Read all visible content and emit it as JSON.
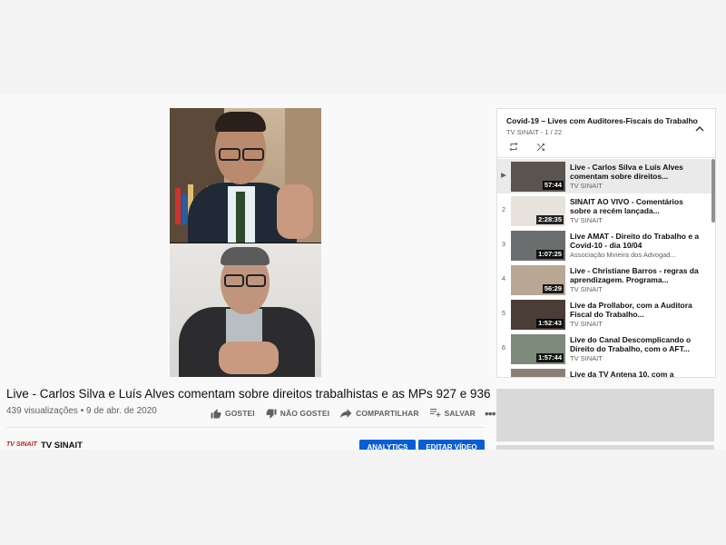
{
  "video": {
    "title": "Live - Carlos Silva e Luís Alves comentam sobre direitos trabalhistas e as MPs 927 e 936",
    "views": "439 visualizações",
    "date": "9 de abr. de 2020"
  },
  "actions": {
    "like": "GOSTEI",
    "dislike": "NÃO GOSTEI",
    "share": "COMPARTILHAR",
    "save": "SALVAR",
    "more": "•••"
  },
  "channel": {
    "logo_text": "TV SINAIT",
    "name": "TV SINAIT",
    "analytics_label": "ANALYTICS",
    "edit_label": "EDITAR VÍDEO"
  },
  "playlist": {
    "title": "Covid-19 – Lives com Auditores-Fiscais do Trabalho",
    "subtitle": "TV SINAIT - 1 / 22",
    "items": [
      {
        "index": "▶",
        "title": "Live - Carlos Silva e Luís Alves comentam sobre direitos...",
        "channel": "TV SINAIT",
        "duration": "57:44",
        "thumb_color": "#5a5450"
      },
      {
        "index": "2",
        "title": "SINAIT AO VIVO - Comentários sobre a recém lançada...",
        "channel": "TV SINAIT",
        "duration": "2:28:35",
        "thumb_color": "#e8e2dc"
      },
      {
        "index": "3",
        "title": "Live AMAT - Direito do Trabalho e a Covid-10 - dia 10/04",
        "channel": "Associação Mineira dos Advogad...",
        "duration": "1:07:25",
        "thumb_color": "#6b6e6f"
      },
      {
        "index": "4",
        "title": "Live - Christiane Barros - regras da aprendizagem. Programa...",
        "channel": "TV SINAIT",
        "duration": "56:29",
        "thumb_color": "#b9a796"
      },
      {
        "index": "5",
        "title": "Live da Prollabor, com a Auditora Fiscal do Trabalho...",
        "channel": "TV SINAIT",
        "duration": "1:52:43",
        "thumb_color": "#4a3d36"
      },
      {
        "index": "6",
        "title": "Live do Canal Descomplicando o Direito do Trabalho, com o AFT...",
        "channel": "TV SINAIT",
        "duration": "1:57:44",
        "thumb_color": "#7d8a7c"
      },
      {
        "index": "",
        "title": "Live da TV Antena 10, com a",
        "channel": "",
        "duration": "",
        "thumb_color": "#8a7f77"
      }
    ]
  },
  "colors": {
    "accent": "#065fd4",
    "logo_red": "#c51d1d"
  }
}
